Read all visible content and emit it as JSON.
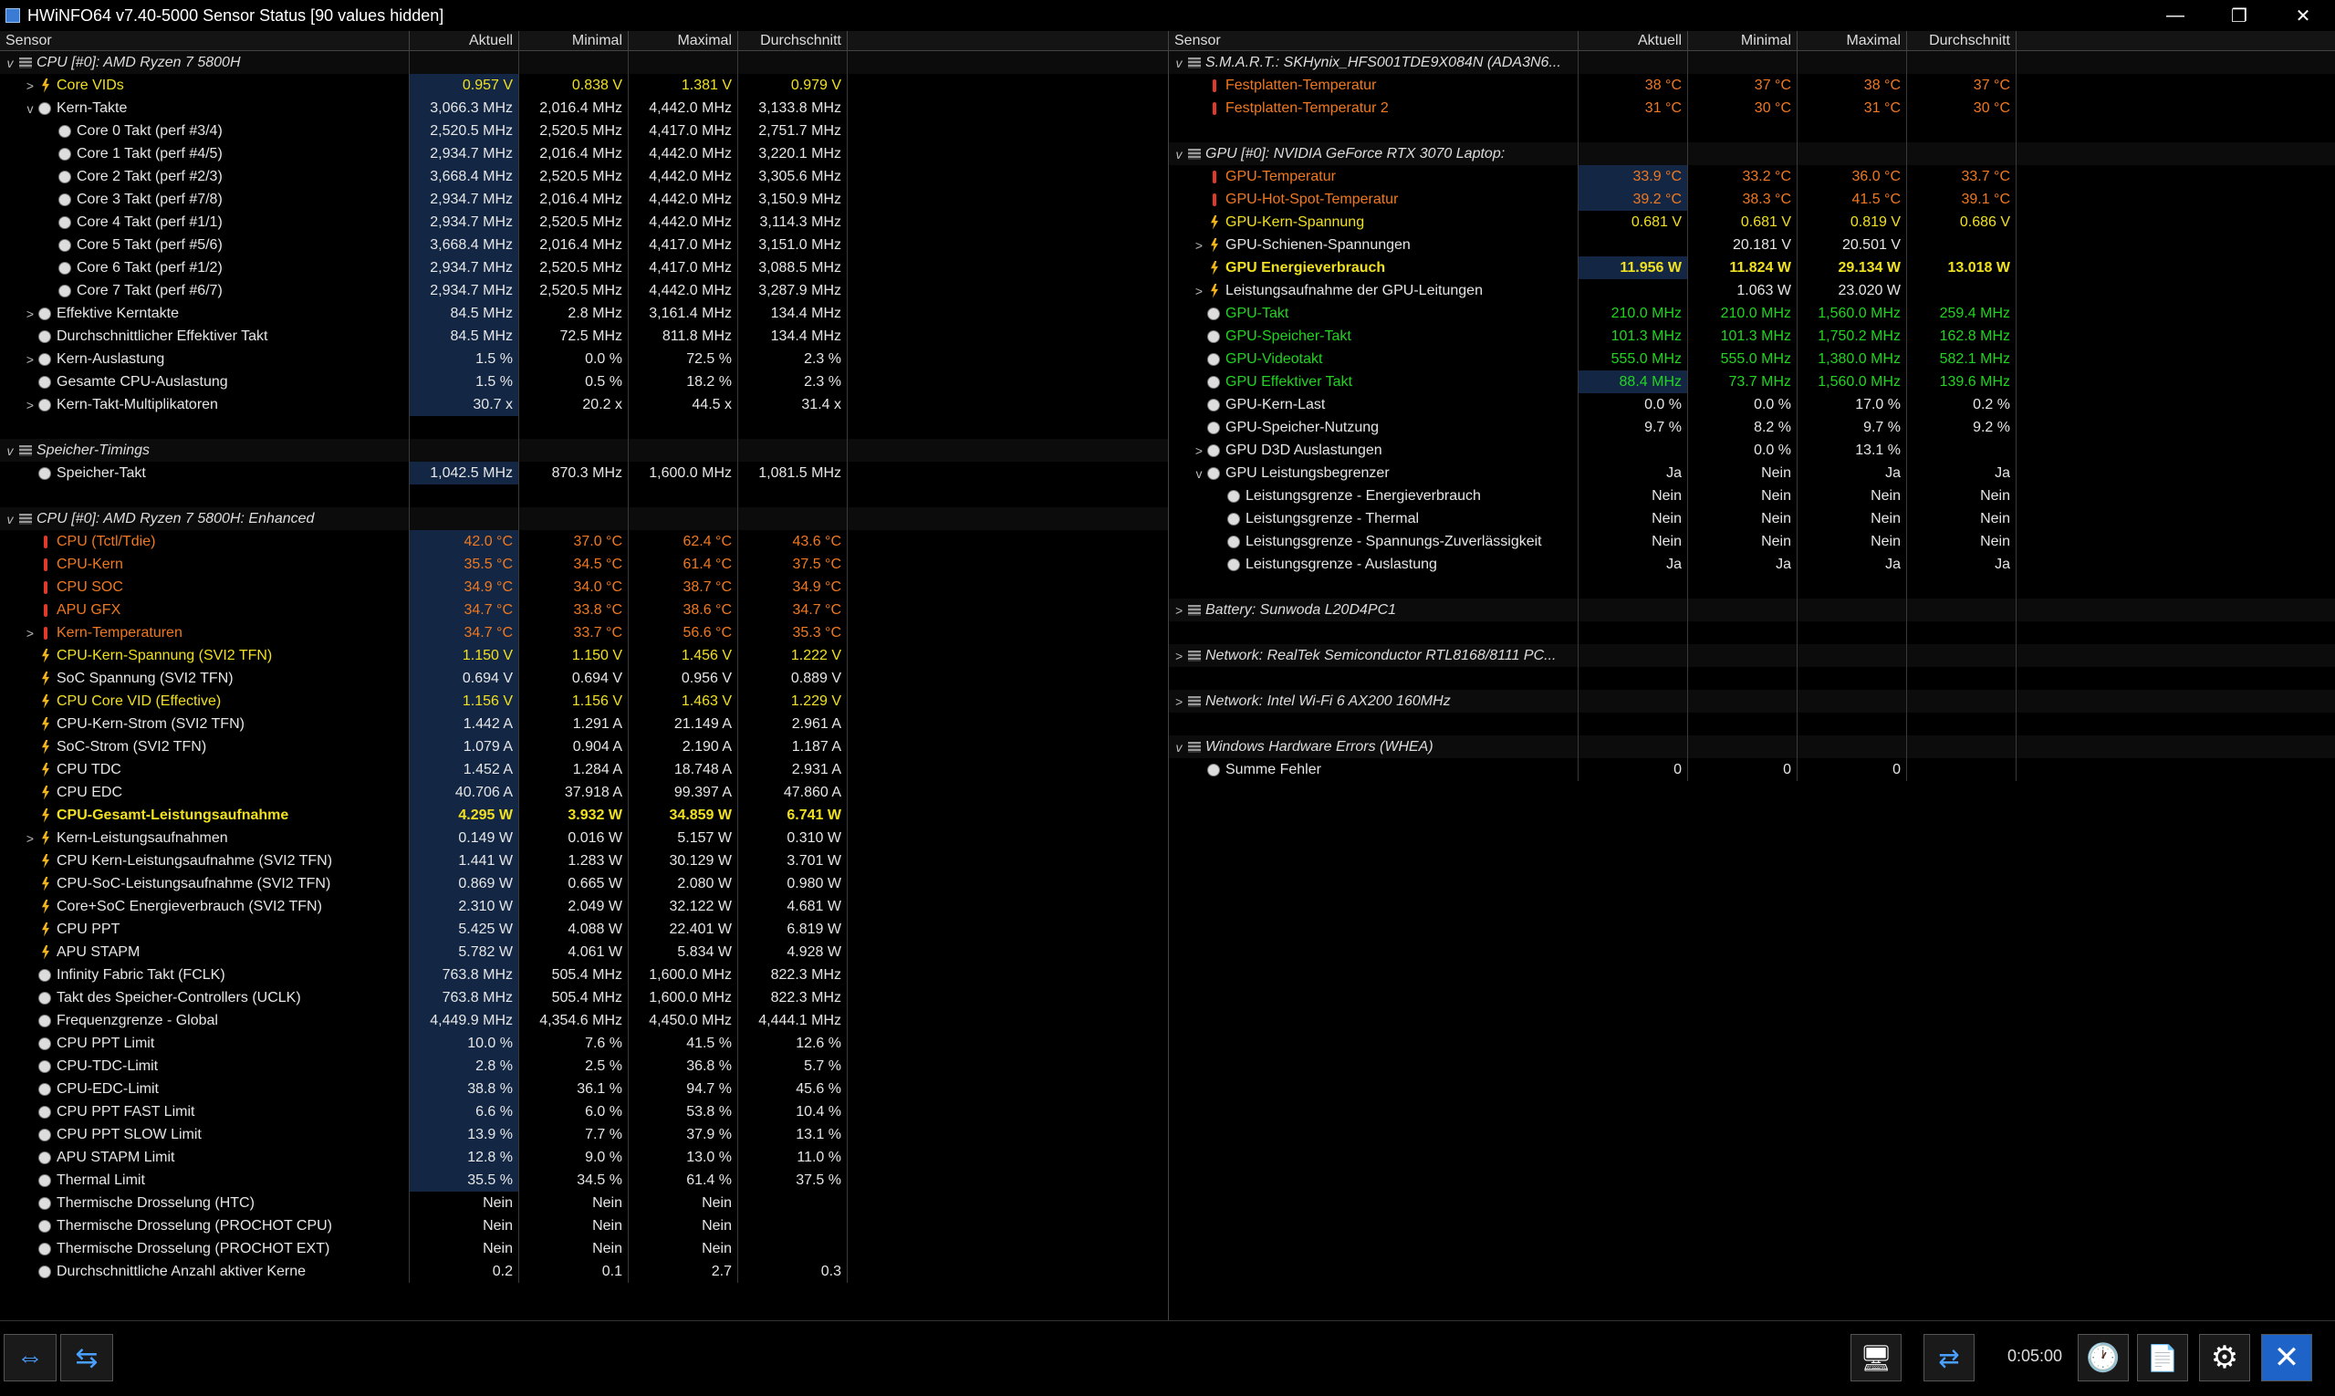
{
  "window": {
    "title": "HWiNFO64 v7.40-5000 Sensor Status [90 values hidden]",
    "minimize": "—",
    "maximize": "❐",
    "close": "✕"
  },
  "columns": [
    "Sensor",
    "Aktuell",
    "Minimal",
    "Maximal",
    "Durchschnitt"
  ],
  "left_rows": [
    {
      "type": "group",
      "exp": "v",
      "icon": "chip",
      "name": "CPU [#0]: AMD Ryzen 7 5800H",
      "vals": [
        "",
        "",
        "",
        ""
      ]
    },
    {
      "exp": ">",
      "indent": 1,
      "icon": "bolt",
      "name": "Core VIDs",
      "vals": [
        "0.957 V",
        "0.838 V",
        "1.381 V",
        "0.979 V"
      ],
      "color": "yellow",
      "hl": true
    },
    {
      "exp": "v",
      "indent": 1,
      "icon": "clock",
      "name": "Kern-Takte",
      "vals": [
        "3,066.3 MHz",
        "2,016.4 MHz",
        "4,442.0 MHz",
        "3,133.8 MHz"
      ],
      "hl": true
    },
    {
      "indent": 2,
      "icon": "clock",
      "name": "Core 0 Takt (perf #3/4)",
      "vals": [
        "2,520.5 MHz",
        "2,520.5 MHz",
        "4,417.0 MHz",
        "2,751.7 MHz"
      ],
      "hl": true
    },
    {
      "indent": 2,
      "icon": "clock",
      "name": "Core 1 Takt (perf #4/5)",
      "vals": [
        "2,934.7 MHz",
        "2,016.4 MHz",
        "4,442.0 MHz",
        "3,220.1 MHz"
      ],
      "hl": true
    },
    {
      "indent": 2,
      "icon": "clock",
      "name": "Core 2 Takt (perf #2/3)",
      "vals": [
        "3,668.4 MHz",
        "2,520.5 MHz",
        "4,442.0 MHz",
        "3,305.6 MHz"
      ],
      "hl": true
    },
    {
      "indent": 2,
      "icon": "clock",
      "name": "Core 3 Takt (perf #7/8)",
      "vals": [
        "2,934.7 MHz",
        "2,016.4 MHz",
        "4,442.0 MHz",
        "3,150.9 MHz"
      ],
      "hl": true
    },
    {
      "indent": 2,
      "icon": "clock",
      "name": "Core 4 Takt (perf #1/1)",
      "vals": [
        "2,934.7 MHz",
        "2,520.5 MHz",
        "4,442.0 MHz",
        "3,114.3 MHz"
      ],
      "hl": true
    },
    {
      "indent": 2,
      "icon": "clock",
      "name": "Core 5 Takt (perf #5/6)",
      "vals": [
        "3,668.4 MHz",
        "2,016.4 MHz",
        "4,417.0 MHz",
        "3,151.0 MHz"
      ],
      "hl": true
    },
    {
      "indent": 2,
      "icon": "clock",
      "name": "Core 6 Takt (perf #1/2)",
      "vals": [
        "2,934.7 MHz",
        "2,520.5 MHz",
        "4,417.0 MHz",
        "3,088.5 MHz"
      ],
      "hl": true
    },
    {
      "indent": 2,
      "icon": "clock",
      "name": "Core 7 Takt (perf #6/7)",
      "vals": [
        "2,934.7 MHz",
        "2,520.5 MHz",
        "4,442.0 MHz",
        "3,287.9 MHz"
      ],
      "hl": true
    },
    {
      "exp": ">",
      "indent": 1,
      "icon": "clock",
      "name": "Effektive Kerntakte",
      "vals": [
        "84.5 MHz",
        "2.8 MHz",
        "3,161.4 MHz",
        "134.4 MHz"
      ],
      "hl": true
    },
    {
      "indent": 1,
      "icon": "clock",
      "name": "Durchschnittlicher Effektiver Takt",
      "vals": [
        "84.5 MHz",
        "72.5 MHz",
        "811.8 MHz",
        "134.4 MHz"
      ],
      "hl": true
    },
    {
      "exp": ">",
      "indent": 1,
      "icon": "clock",
      "name": "Kern-Auslastung",
      "vals": [
        "1.5 %",
        "0.0 %",
        "72.5 %",
        "2.3 %"
      ],
      "hl": true
    },
    {
      "indent": 1,
      "icon": "clock",
      "name": "Gesamte CPU-Auslastung",
      "vals": [
        "1.5 %",
        "0.5 %",
        "18.2 %",
        "2.3 %"
      ],
      "hl": true
    },
    {
      "exp": ">",
      "indent": 1,
      "icon": "clock",
      "name": "Kern-Takt-Multiplikatoren",
      "vals": [
        "30.7 x",
        "20.2 x",
        "44.5 x",
        "31.4 x"
      ],
      "hl": true
    },
    {
      "type": "blank"
    },
    {
      "type": "group",
      "exp": "v",
      "icon": "chip",
      "name": "Speicher-Timings",
      "vals": [
        "",
        "",
        "",
        ""
      ]
    },
    {
      "indent": 1,
      "icon": "clock",
      "name": "Speicher-Takt",
      "vals": [
        "1,042.5 MHz",
        "870.3 MHz",
        "1,600.0 MHz",
        "1,081.5 MHz"
      ],
      "hl": true
    },
    {
      "type": "blank"
    },
    {
      "type": "group",
      "exp": "v",
      "icon": "chip",
      "name": "CPU [#0]: AMD Ryzen 7 5800H: Enhanced",
      "vals": [
        "",
        "",
        "",
        ""
      ]
    },
    {
      "indent": 1,
      "icon": "therm",
      "name": "CPU (Tctl/Tdie)",
      "vals": [
        "42.0 °C",
        "37.0 °C",
        "62.4 °C",
        "43.6 °C"
      ],
      "color": "orange",
      "hl": true
    },
    {
      "indent": 1,
      "icon": "therm",
      "name": "CPU-Kern",
      "vals": [
        "35.5 °C",
        "34.5 °C",
        "61.4 °C",
        "37.5 °C"
      ],
      "color": "orange",
      "hl": true
    },
    {
      "indent": 1,
      "icon": "therm",
      "name": "CPU SOC",
      "vals": [
        "34.9 °C",
        "34.0 °C",
        "38.7 °C",
        "34.9 °C"
      ],
      "color": "orange",
      "hl": true
    },
    {
      "indent": 1,
      "icon": "therm",
      "name": "APU GFX",
      "vals": [
        "34.7 °C",
        "33.8 °C",
        "38.6 °C",
        "34.7 °C"
      ],
      "color": "orange",
      "hl": true
    },
    {
      "exp": ">",
      "indent": 1,
      "icon": "therm",
      "name": "Kern-Temperaturen",
      "vals": [
        "34.7 °C",
        "33.7 °C",
        "56.6 °C",
        "35.3 °C"
      ],
      "color": "orange",
      "hl": true
    },
    {
      "indent": 1,
      "icon": "bolt",
      "name": "CPU-Kern-Spannung (SVI2 TFN)",
      "vals": [
        "1.150 V",
        "1.150 V",
        "1.456 V",
        "1.222 V"
      ],
      "color": "yellow",
      "hl": true
    },
    {
      "indent": 1,
      "icon": "bolt",
      "name": "SoC Spannung (SVI2 TFN)",
      "vals": [
        "0.694 V",
        "0.694 V",
        "0.956 V",
        "0.889 V"
      ],
      "hl": true
    },
    {
      "indent": 1,
      "icon": "bolt",
      "name": "CPU Core VID (Effective)",
      "vals": [
        "1.156 V",
        "1.156 V",
        "1.463 V",
        "1.229 V"
      ],
      "color": "yellow",
      "hl": true
    },
    {
      "indent": 1,
      "icon": "bolt",
      "name": "CPU-Kern-Strom (SVI2 TFN)",
      "vals": [
        "1.442 A",
        "1.291 A",
        "21.149 A",
        "2.961 A"
      ],
      "hl": true
    },
    {
      "indent": 1,
      "icon": "bolt",
      "name": "SoC-Strom (SVI2 TFN)",
      "vals": [
        "1.079 A",
        "0.904 A",
        "2.190 A",
        "1.187 A"
      ],
      "hl": true
    },
    {
      "indent": 1,
      "icon": "bolt",
      "name": "CPU TDC",
      "vals": [
        "1.452 A",
        "1.284 A",
        "18.748 A",
        "2.931 A"
      ],
      "hl": true
    },
    {
      "indent": 1,
      "icon": "bolt",
      "name": "CPU EDC",
      "vals": [
        "40.706 A",
        "37.918 A",
        "99.397 A",
        "47.860 A"
      ],
      "hl": true
    },
    {
      "indent": 1,
      "icon": "bolt",
      "name": "CPU-Gesamt-Leistungsaufnahme",
      "vals": [
        "4.295 W",
        "3.932 W",
        "34.859 W",
        "6.741 W"
      ],
      "color": "yellow",
      "bold": true,
      "hl": true
    },
    {
      "exp": ">",
      "indent": 1,
      "icon": "bolt",
      "name": "Kern-Leistungsaufnahmen",
      "vals": [
        "0.149 W",
        "0.016 W",
        "5.157 W",
        "0.310 W"
      ],
      "hl": true
    },
    {
      "indent": 1,
      "icon": "bolt",
      "name": "CPU Kern-Leistungsaufnahme (SVI2 TFN)",
      "vals": [
        "1.441 W",
        "1.283 W",
        "30.129 W",
        "3.701 W"
      ],
      "hl": true
    },
    {
      "indent": 1,
      "icon": "bolt",
      "name": "CPU-SoC-Leistungsaufnahme (SVI2 TFN)",
      "vals": [
        "0.869 W",
        "0.665 W",
        "2.080 W",
        "0.980 W"
      ],
      "hl": true
    },
    {
      "indent": 1,
      "icon": "bolt",
      "name": "Core+SoC Energieverbrauch (SVI2 TFN)",
      "vals": [
        "2.310 W",
        "2.049 W",
        "32.122 W",
        "4.681 W"
      ],
      "hl": true
    },
    {
      "indent": 1,
      "icon": "bolt",
      "name": "CPU PPT",
      "vals": [
        "5.425 W",
        "4.088 W",
        "22.401 W",
        "6.819 W"
      ],
      "hl": true
    },
    {
      "indent": 1,
      "icon": "bolt",
      "name": "APU STAPM",
      "vals": [
        "5.782 W",
        "4.061 W",
        "5.834 W",
        "4.928 W"
      ],
      "hl": true
    },
    {
      "indent": 1,
      "icon": "clock",
      "name": "Infinity Fabric Takt (FCLK)",
      "vals": [
        "763.8 MHz",
        "505.4 MHz",
        "1,600.0 MHz",
        "822.3 MHz"
      ],
      "hl": true
    },
    {
      "indent": 1,
      "icon": "clock",
      "name": "Takt des Speicher-Controllers (UCLK)",
      "vals": [
        "763.8 MHz",
        "505.4 MHz",
        "1,600.0 MHz",
        "822.3 MHz"
      ],
      "hl": true
    },
    {
      "indent": 1,
      "icon": "clock",
      "name": "Frequenzgrenze - Global",
      "vals": [
        "4,449.9 MHz",
        "4,354.6 MHz",
        "4,450.0 MHz",
        "4,444.1 MHz"
      ],
      "hl": true
    },
    {
      "indent": 1,
      "icon": "clock",
      "name": "CPU PPT Limit",
      "vals": [
        "10.0 %",
        "7.6 %",
        "41.5 %",
        "12.6 %"
      ],
      "hl": true
    },
    {
      "indent": 1,
      "icon": "clock",
      "name": "CPU-TDC-Limit",
      "vals": [
        "2.8 %",
        "2.5 %",
        "36.8 %",
        "5.7 %"
      ],
      "hl": true
    },
    {
      "indent": 1,
      "icon": "clock",
      "name": "CPU-EDC-Limit",
      "vals": [
        "38.8 %",
        "36.1 %",
        "94.7 %",
        "45.6 %"
      ],
      "hl": true
    },
    {
      "indent": 1,
      "icon": "clock",
      "name": "CPU PPT FAST Limit",
      "vals": [
        "6.6 %",
        "6.0 %",
        "53.8 %",
        "10.4 %"
      ],
      "hl": true
    },
    {
      "indent": 1,
      "icon": "clock",
      "name": "CPU PPT SLOW Limit",
      "vals": [
        "13.9 %",
        "7.7 %",
        "37.9 %",
        "13.1 %"
      ],
      "hl": true
    },
    {
      "indent": 1,
      "icon": "clock",
      "name": "APU STAPM Limit",
      "vals": [
        "12.8 %",
        "9.0 %",
        "13.0 %",
        "11.0 %"
      ],
      "hl": true
    },
    {
      "indent": 1,
      "icon": "clock",
      "name": "Thermal Limit",
      "vals": [
        "35.5 %",
        "34.5 %",
        "61.4 %",
        "37.5 %"
      ],
      "hl": true
    },
    {
      "indent": 1,
      "icon": "clock",
      "name": "Thermische Drosselung (HTC)",
      "vals": [
        "Nein",
        "Nein",
        "Nein",
        ""
      ]
    },
    {
      "indent": 1,
      "icon": "clock",
      "name": "Thermische Drosselung (PROCHOT CPU)",
      "vals": [
        "Nein",
        "Nein",
        "Nein",
        ""
      ]
    },
    {
      "indent": 1,
      "icon": "clock",
      "name": "Thermische Drosselung (PROCHOT EXT)",
      "vals": [
        "Nein",
        "Nein",
        "Nein",
        ""
      ]
    },
    {
      "indent": 1,
      "icon": "clock",
      "name": "Durchschnittliche Anzahl aktiver Kerne",
      "vals": [
        "0.2",
        "0.1",
        "2.7",
        "0.3"
      ]
    }
  ],
  "right_rows": [
    {
      "type": "group",
      "exp": "v",
      "icon": "chip",
      "name": "S.M.A.R.T.: SKHynix_HFS001TDE9X084N (ADA3N6...",
      "vals": [
        "",
        "",
        "",
        ""
      ]
    },
    {
      "indent": 1,
      "icon": "therm",
      "name": "Festplatten-Temperatur",
      "vals": [
        "38 °C",
        "37 °C",
        "38 °C",
        "37 °C"
      ],
      "color": "orange"
    },
    {
      "indent": 1,
      "icon": "therm",
      "name": "Festplatten-Temperatur 2",
      "vals": [
        "31 °C",
        "30 °C",
        "31 °C",
        "30 °C"
      ],
      "color": "orange"
    },
    {
      "type": "blank"
    },
    {
      "type": "group",
      "exp": "v",
      "icon": "chip",
      "name": "GPU [#0]: NVIDIA GeForce RTX 3070 Laptop:",
      "vals": [
        "",
        "",
        "",
        ""
      ]
    },
    {
      "indent": 1,
      "icon": "therm",
      "name": "GPU-Temperatur",
      "vals": [
        "33.9 °C",
        "33.2 °C",
        "36.0 °C",
        "33.7 °C"
      ],
      "color": "orange",
      "hl": true
    },
    {
      "indent": 1,
      "icon": "therm",
      "name": "GPU-Hot-Spot-Temperatur",
      "vals": [
        "39.2 °C",
        "38.3 °C",
        "41.5 °C",
        "39.1 °C"
      ],
      "color": "orange",
      "hl": true
    },
    {
      "indent": 1,
      "icon": "bolt",
      "name": "GPU-Kern-Spannung",
      "vals": [
        "0.681 V",
        "0.681 V",
        "0.819 V",
        "0.686 V"
      ],
      "color": "yellow"
    },
    {
      "exp": ">",
      "indent": 1,
      "icon": "bolt",
      "name": "GPU-Schienen-Spannungen",
      "vals": [
        "",
        "20.181 V",
        "20.501 V",
        ""
      ]
    },
    {
      "indent": 1,
      "icon": "bolt",
      "name": "GPU Energieverbrauch",
      "vals": [
        "11.956 W",
        "11.824 W",
        "29.134 W",
        "13.018 W"
      ],
      "color": "yellow",
      "bold": true,
      "hl": true
    },
    {
      "exp": ">",
      "indent": 1,
      "icon": "bolt",
      "name": "Leistungsaufnahme der GPU-Leitungen",
      "vals": [
        "",
        "1.063 W",
        "23.020 W",
        ""
      ]
    },
    {
      "indent": 1,
      "icon": "clock",
      "name": "GPU-Takt",
      "vals": [
        "210.0 MHz",
        "210.0 MHz",
        "1,560.0 MHz",
        "259.4 MHz"
      ],
      "color": "green"
    },
    {
      "indent": 1,
      "icon": "clock",
      "name": "GPU-Speicher-Takt",
      "vals": [
        "101.3 MHz",
        "101.3 MHz",
        "1,750.2 MHz",
        "162.8 MHz"
      ],
      "color": "green"
    },
    {
      "indent": 1,
      "icon": "clock",
      "name": "GPU-Videotakt",
      "vals": [
        "555.0 MHz",
        "555.0 MHz",
        "1,380.0 MHz",
        "582.1 MHz"
      ],
      "color": "green"
    },
    {
      "indent": 1,
      "icon": "clock",
      "name": "GPU Effektiver Takt",
      "vals": [
        "88.4 MHz",
        "73.7 MHz",
        "1,560.0 MHz",
        "139.6 MHz"
      ],
      "color": "green",
      "hl": true
    },
    {
      "indent": 1,
      "icon": "clock",
      "name": "GPU-Kern-Last",
      "vals": [
        "0.0 %",
        "0.0 %",
        "17.0 %",
        "0.2 %"
      ]
    },
    {
      "indent": 1,
      "icon": "clock",
      "name": "GPU-Speicher-Nutzung",
      "vals": [
        "9.7 %",
        "8.2 %",
        "9.7 %",
        "9.2 %"
      ]
    },
    {
      "exp": ">",
      "indent": 1,
      "icon": "clock",
      "name": "GPU D3D Auslastungen",
      "vals": [
        "",
        "0.0 %",
        "13.1 %",
        ""
      ]
    },
    {
      "exp": "v",
      "indent": 1,
      "icon": "clock",
      "name": "GPU Leistungsbegrenzer",
      "vals": [
        "Ja",
        "Nein",
        "Ja",
        "Ja"
      ]
    },
    {
      "indent": 2,
      "icon": "clock",
      "name": "Leistungsgrenze - Energieverbrauch",
      "vals": [
        "Nein",
        "Nein",
        "Nein",
        "Nein"
      ]
    },
    {
      "indent": 2,
      "icon": "clock",
      "name": "Leistungsgrenze - Thermal",
      "vals": [
        "Nein",
        "Nein",
        "Nein",
        "Nein"
      ]
    },
    {
      "indent": 2,
      "icon": "clock",
      "name": "Leistungsgrenze - Spannungs-Zuverlässigkeit",
      "vals": [
        "Nein",
        "Nein",
        "Nein",
        "Nein"
      ]
    },
    {
      "indent": 2,
      "icon": "clock",
      "name": "Leistungsgrenze - Auslastung",
      "vals": [
        "Ja",
        "Ja",
        "Ja",
        "Ja"
      ]
    },
    {
      "type": "blank"
    },
    {
      "type": "group",
      "exp": ">",
      "icon": "chip",
      "name": "Battery: Sunwoda L20D4PC1",
      "vals": [
        "",
        "",
        "",
        ""
      ]
    },
    {
      "type": "blank"
    },
    {
      "type": "group",
      "exp": ">",
      "icon": "chip",
      "name": "Network: RealTek Semiconductor RTL8168/8111 PC...",
      "vals": [
        "",
        "",
        "",
        ""
      ]
    },
    {
      "type": "blank"
    },
    {
      "type": "group",
      "exp": ">",
      "icon": "chip",
      "name": "Network: Intel Wi-Fi 6 AX200 160MHz",
      "vals": [
        "",
        "",
        "",
        ""
      ]
    },
    {
      "type": "blank"
    },
    {
      "type": "group",
      "exp": "v",
      "icon": "chip",
      "name": "Windows Hardware Errors (WHEA)",
      "vals": [
        "",
        "",
        "",
        ""
      ]
    },
    {
      "indent": 1,
      "icon": "clock",
      "name": "Summe Fehler",
      "vals": [
        "0",
        "0",
        "0",
        ""
      ]
    }
  ],
  "toolbar": {
    "timer": "0:05:00",
    "nav_left": "⇔",
    "nav_right": "⇆",
    "btn_network": "🖥",
    "btn_net2": "⇄",
    "btn_clock": "🕐",
    "btn_report": "📄",
    "btn_settings": "⚙",
    "btn_close": "✕"
  }
}
